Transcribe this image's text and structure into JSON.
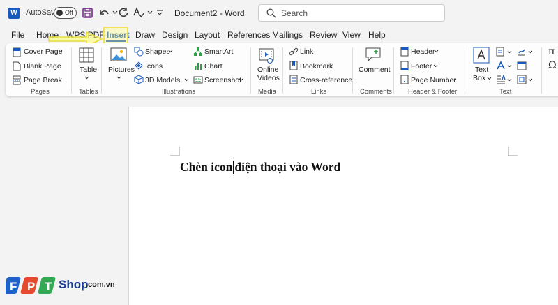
{
  "titlebar": {
    "app_logo": "W",
    "autosave_label": "AutoSave",
    "autosave_state": "Off",
    "document_title": "Document2",
    "separator": "-",
    "app_name": "Word",
    "search_placeholder": "Search"
  },
  "tabs": [
    "File",
    "Home",
    "WPS PDF",
    "Insert",
    "Draw",
    "Design",
    "Layout",
    "References",
    "Mailings",
    "Review",
    "View",
    "Help"
  ],
  "active_tab": "Insert",
  "ribbon": {
    "pages": {
      "cover_page": "Cover Page",
      "blank_page": "Blank Page",
      "page_break": "Page Break",
      "label": "Pages"
    },
    "tables": {
      "table": "Table",
      "label": "Tables"
    },
    "illustrations": {
      "pictures": "Pictures",
      "shapes": "Shapes",
      "icons": "Icons",
      "models": "3D Models",
      "smartart": "SmartArt",
      "chart": "Chart",
      "screenshot": "Screenshot",
      "label": "Illustrations"
    },
    "media": {
      "online": "Online",
      "videos": "Videos",
      "label": "Media"
    },
    "links": {
      "link": "Link",
      "bookmark": "Bookmark",
      "cross_ref": "Cross-reference",
      "label": "Links"
    },
    "comments": {
      "comment": "Comment",
      "label": "Comments"
    },
    "header_footer": {
      "header": "Header",
      "footer": "Footer",
      "page_number": "Page Number",
      "label": "Header & Footer"
    },
    "text": {
      "text": "Text",
      "box": "Box",
      "label": "Text"
    },
    "symbols": {
      "pi": "π",
      "omega": "Ω"
    }
  },
  "document": {
    "before_cursor": "Chèn icon",
    "after_cursor": "điện thoại vào Word"
  },
  "watermark": {
    "brand": "FPT",
    "shop": "Shop",
    "domain": ".com.vn"
  },
  "colors": {
    "accent": "#185abd",
    "highlight": "#f0e45a",
    "page": "#ffffff"
  }
}
